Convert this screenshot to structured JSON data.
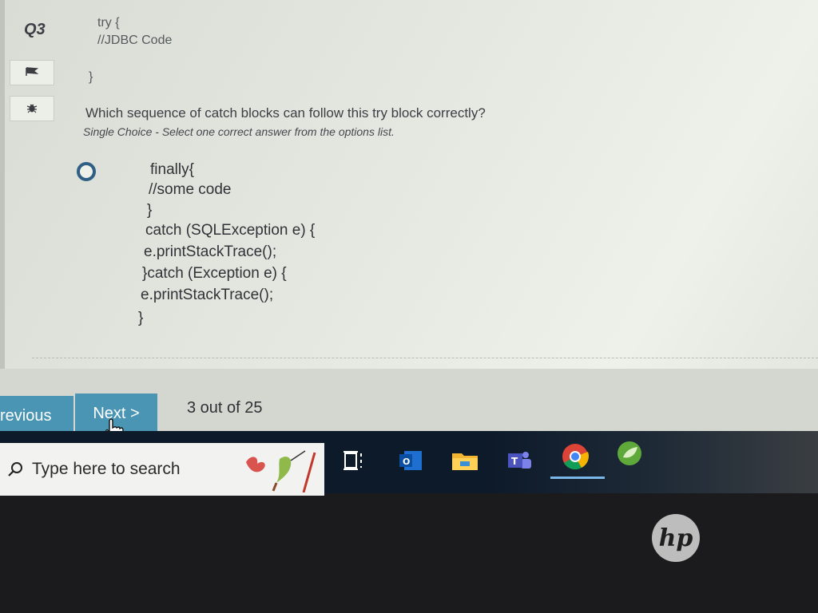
{
  "question": {
    "number": "Q3",
    "code_lines": [
      "try {",
      "//JDBC Code",
      "}"
    ],
    "text": "Which sequence of catch blocks can follow this try block correctly?",
    "instruction": "Single Choice - Select one correct answer from the options list."
  },
  "sidebar": {
    "flag_icon": "flag-icon",
    "bug_icon": "bug-icon"
  },
  "option": {
    "lines": [
      "finally{",
      "//some code",
      "}",
      "catch (SQLException e) {",
      "e.printStackTrace();",
      "}catch (Exception e) {",
      "e.printStackTrace();",
      "}"
    ]
  },
  "nav": {
    "previous_label": "revious",
    "next_label": "Next >",
    "progress": "3 out of 25"
  },
  "taskbar": {
    "search_placeholder": "Type here to search",
    "icons": [
      "task-view-icon",
      "outlook-icon",
      "file-explorer-icon",
      "teams-icon",
      "chrome-icon",
      "spring-icon"
    ]
  },
  "brand": {
    "logo": "hp"
  },
  "colors": {
    "accent": "#4a95b4",
    "radio": "#2f5f85",
    "taskbar": "#0d1a2a"
  }
}
